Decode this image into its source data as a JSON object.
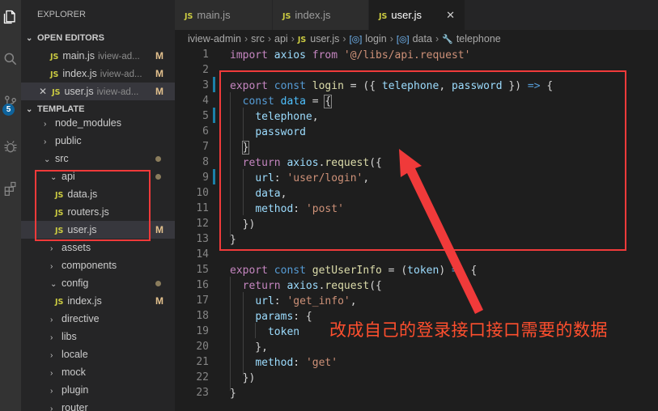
{
  "sidebar": {
    "header": "EXPLORER",
    "open_editors": {
      "title": "OPEN EDITORS",
      "items": [
        {
          "icon": "JS",
          "name": "main.js",
          "desc": "iview-ad...",
          "status": "M"
        },
        {
          "icon": "JS",
          "name": "index.js",
          "desc": "iview-ad...",
          "status": "M"
        },
        {
          "icon": "JS",
          "name": "user.js",
          "desc": "iview-ad...",
          "status": "M"
        }
      ]
    },
    "project": {
      "title": "TEMPLATE",
      "tree": [
        {
          "name": "node_modules",
          "chevron": "›"
        },
        {
          "name": "public",
          "chevron": "›"
        },
        {
          "name": "src",
          "chevron": "⌄"
        },
        {
          "name": "api",
          "chevron": "⌄"
        },
        {
          "name": "data.js",
          "icon": "JS"
        },
        {
          "name": "routers.js",
          "icon": "JS"
        },
        {
          "name": "user.js",
          "icon": "JS",
          "status": "M"
        },
        {
          "name": "assets",
          "chevron": "›"
        },
        {
          "name": "components",
          "chevron": "›"
        },
        {
          "name": "config",
          "chevron": "⌄"
        },
        {
          "name": "index.js",
          "icon": "JS",
          "status": "M"
        },
        {
          "name": "directive",
          "chevron": "›"
        },
        {
          "name": "libs",
          "chevron": "›"
        },
        {
          "name": "locale",
          "chevron": "›"
        },
        {
          "name": "mock",
          "chevron": "›"
        },
        {
          "name": "plugin",
          "chevron": "›"
        },
        {
          "name": "router",
          "chevron": "›"
        }
      ]
    },
    "activity_badge": "5"
  },
  "tabs": [
    {
      "icon": "JS",
      "label": "main.js"
    },
    {
      "icon": "JS",
      "label": "index.js"
    },
    {
      "icon": "JS",
      "label": "user.js",
      "close": "✕"
    }
  ],
  "breadcrumb": [
    "iview-admin",
    "src",
    "api",
    "user.js",
    "login",
    "data",
    "telephone"
  ],
  "editor": {
    "line_numbers": [
      "1",
      "2",
      "3",
      "4",
      "5",
      "6",
      "7",
      "8",
      "9",
      "10",
      "11",
      "12",
      "13",
      "14",
      "15",
      "16",
      "17",
      "18",
      "19",
      "20",
      "21",
      "22",
      "23"
    ]
  },
  "annotation": {
    "note": "改成自己的登录接口接口需要的数据",
    "color": "#f03a3a"
  }
}
